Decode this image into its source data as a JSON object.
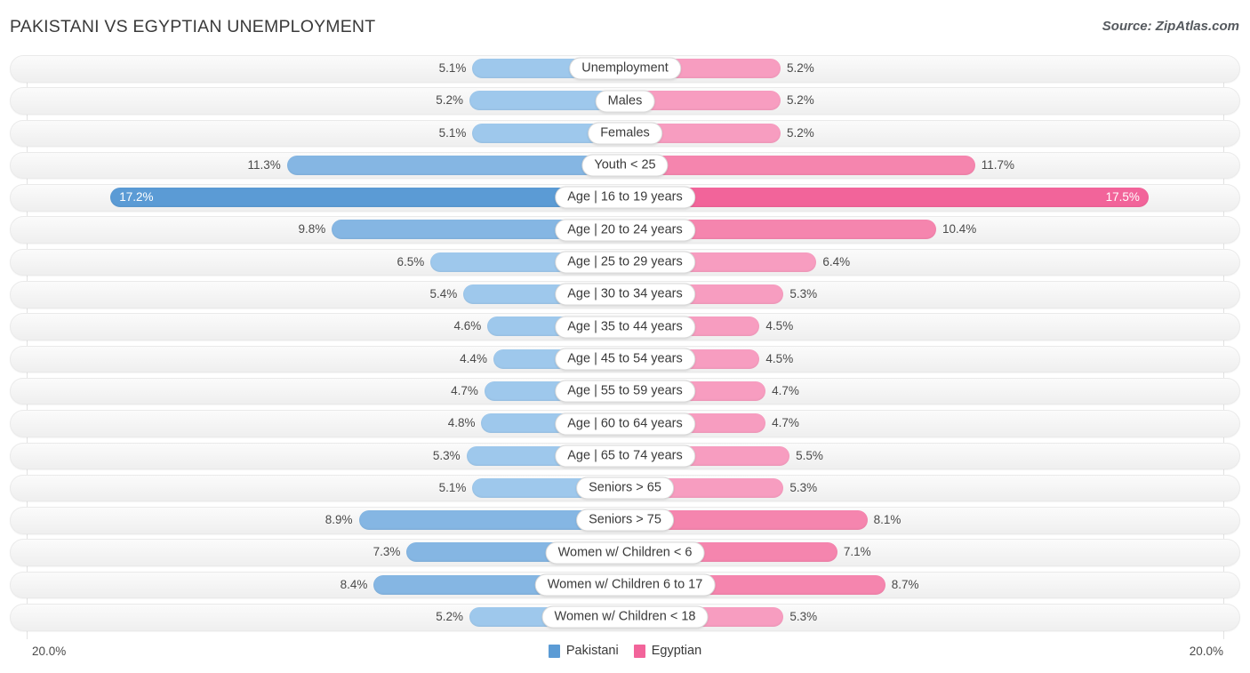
{
  "header": {
    "title": "PAKISTANI VS EGYPTIAN UNEMPLOYMENT",
    "source": "Source: ZipAtlas.com"
  },
  "axis": {
    "left_label": "20.0%",
    "right_label": "20.0%",
    "max": 20.0
  },
  "legend": [
    {
      "label": "Pakistani",
      "color": "#5b9bd5"
    },
    {
      "label": "Egyptian",
      "color": "#f2649a"
    }
  ],
  "colors": {
    "left_normal": "#9ec8ec",
    "left_mid": "#85b6e3",
    "left_strong": "#5b9bd5",
    "right_normal": "#f79dc0",
    "right_mid": "#f585ae",
    "right_strong": "#f2649a",
    "track_bg": "#f4f4f4",
    "gridline": "#e2e2e2"
  },
  "chart_data": {
    "type": "bar",
    "title": "PAKISTANI VS EGYPTIAN UNEMPLOYMENT",
    "subtitle": "Source: ZipAtlas.com",
    "orientation": "horizontal-diverging",
    "xlabel": "",
    "ylabel": "",
    "xlim": [
      0,
      20.0
    ],
    "unit": "%",
    "grid": true,
    "legend_position": "bottom-center",
    "categories": [
      "Unemployment",
      "Males",
      "Females",
      "Youth < 25",
      "Age | 16 to 19 years",
      "Age | 20 to 24 years",
      "Age | 25 to 29 years",
      "Age | 30 to 34 years",
      "Age | 35 to 44 years",
      "Age | 45 to 54 years",
      "Age | 55 to 59 years",
      "Age | 60 to 64 years",
      "Age | 65 to 74 years",
      "Seniors > 65",
      "Seniors > 75",
      "Women w/ Children < 6",
      "Women w/ Children 6 to 17",
      "Women w/ Children < 18"
    ],
    "series": [
      {
        "name": "Pakistani",
        "values": [
          5.1,
          5.2,
          5.1,
          11.3,
          17.2,
          9.8,
          6.5,
          5.4,
          4.6,
          4.4,
          4.7,
          4.8,
          5.3,
          5.1,
          8.9,
          7.3,
          8.4,
          5.2
        ]
      },
      {
        "name": "Egyptian",
        "values": [
          5.2,
          5.2,
          5.2,
          11.7,
          17.5,
          10.4,
          6.4,
          5.3,
          4.5,
          4.5,
          4.7,
          4.7,
          5.5,
          5.3,
          8.1,
          7.1,
          8.7,
          5.3
        ]
      }
    ]
  },
  "rows": [
    {
      "label": "Unemployment",
      "left_value": 5.1,
      "right_value": 5.2,
      "left_text": "5.1%",
      "right_text": "5.2%",
      "emphasis": 0
    },
    {
      "label": "Males",
      "left_value": 5.2,
      "right_value": 5.2,
      "left_text": "5.2%",
      "right_text": "5.2%",
      "emphasis": 0
    },
    {
      "label": "Females",
      "left_value": 5.1,
      "right_value": 5.2,
      "left_text": "5.1%",
      "right_text": "5.2%",
      "emphasis": 0
    },
    {
      "label": "Youth < 25",
      "left_value": 11.3,
      "right_value": 11.7,
      "left_text": "11.3%",
      "right_text": "11.7%",
      "emphasis": 1
    },
    {
      "label": "Age | 16 to 19 years",
      "left_value": 17.2,
      "right_value": 17.5,
      "left_text": "17.2%",
      "right_text": "17.5%",
      "emphasis": 2
    },
    {
      "label": "Age | 20 to 24 years",
      "left_value": 9.8,
      "right_value": 10.4,
      "left_text": "9.8%",
      "right_text": "10.4%",
      "emphasis": 1
    },
    {
      "label": "Age | 25 to 29 years",
      "left_value": 6.5,
      "right_value": 6.4,
      "left_text": "6.5%",
      "right_text": "6.4%",
      "emphasis": 0
    },
    {
      "label": "Age | 30 to 34 years",
      "left_value": 5.4,
      "right_value": 5.3,
      "left_text": "5.4%",
      "right_text": "5.3%",
      "emphasis": 0
    },
    {
      "label": "Age | 35 to 44 years",
      "left_value": 4.6,
      "right_value": 4.5,
      "left_text": "4.6%",
      "right_text": "4.5%",
      "emphasis": 0
    },
    {
      "label": "Age | 45 to 54 years",
      "left_value": 4.4,
      "right_value": 4.5,
      "left_text": "4.4%",
      "right_text": "4.5%",
      "emphasis": 0
    },
    {
      "label": "Age | 55 to 59 years",
      "left_value": 4.7,
      "right_value": 4.7,
      "left_text": "4.7%",
      "right_text": "4.7%",
      "emphasis": 0
    },
    {
      "label": "Age | 60 to 64 years",
      "left_value": 4.8,
      "right_value": 4.7,
      "left_text": "4.8%",
      "right_text": "4.7%",
      "emphasis": 0
    },
    {
      "label": "Age | 65 to 74 years",
      "left_value": 5.3,
      "right_value": 5.5,
      "left_text": "5.3%",
      "right_text": "5.5%",
      "emphasis": 0
    },
    {
      "label": "Seniors > 65",
      "left_value": 5.1,
      "right_value": 5.3,
      "left_text": "5.1%",
      "right_text": "5.3%",
      "emphasis": 0
    },
    {
      "label": "Seniors > 75",
      "left_value": 8.9,
      "right_value": 8.1,
      "left_text": "8.9%",
      "right_text": "8.1%",
      "emphasis": 1
    },
    {
      "label": "Women w/ Children < 6",
      "left_value": 7.3,
      "right_value": 7.1,
      "left_text": "7.3%",
      "right_text": "7.1%",
      "emphasis": 1
    },
    {
      "label": "Women w/ Children 6 to 17",
      "left_value": 8.4,
      "right_value": 8.7,
      "left_text": "8.4%",
      "right_text": "8.7%",
      "emphasis": 1
    },
    {
      "label": "Women w/ Children < 18",
      "left_value": 5.2,
      "right_value": 5.3,
      "left_text": "5.2%",
      "right_text": "5.3%",
      "emphasis": 0
    }
  ]
}
